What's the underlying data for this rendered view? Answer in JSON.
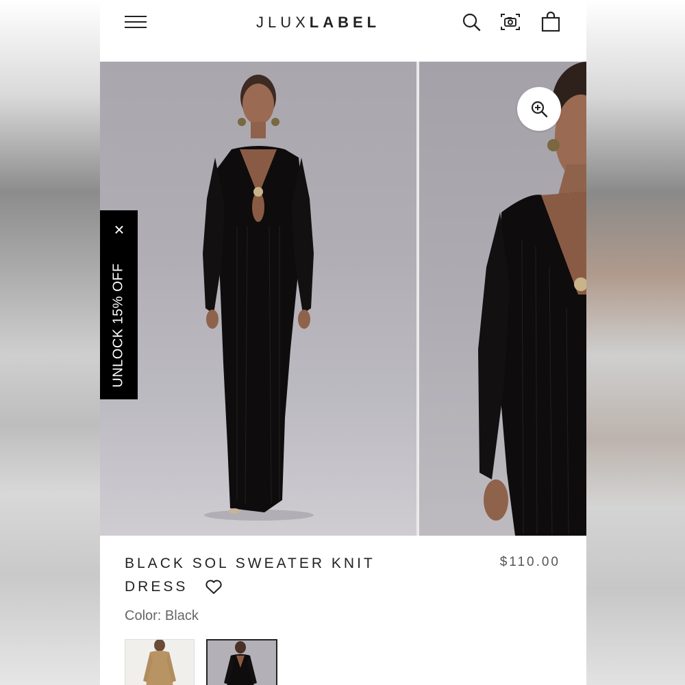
{
  "header": {
    "brand_light": "JLUX",
    "brand_bold": "LABEL",
    "icons": [
      "menu-icon",
      "search-icon",
      "camera-icon",
      "bag-icon"
    ]
  },
  "gallery": {
    "images": [
      "model-front-black-dress",
      "model-closeup-black-dress"
    ],
    "zoom_icon": "zoom-in-icon"
  },
  "promo": {
    "text": "UNLOCK 15% OFF",
    "close": "×"
  },
  "product": {
    "title_line1": "BLACK SOL SWEATER KNIT",
    "title_line2": "DRESS",
    "price": "$110.00",
    "color_label": "Color: Black",
    "wishlist_icon": "heart-icon",
    "swatches": [
      "tan",
      "black"
    ],
    "selected_swatch": "black"
  },
  "colors": {
    "dress": "#0e0c0d",
    "background_studio": "#aeaab2",
    "promo_bg": "#000000",
    "text_primary": "#222222"
  }
}
